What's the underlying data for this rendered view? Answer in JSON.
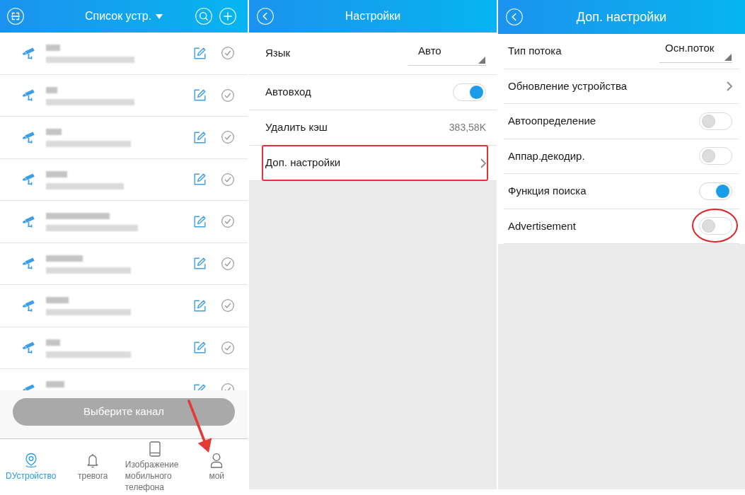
{
  "device_list_screen": {
    "header": {
      "title": "Список устр."
    },
    "devices": [
      {
        "selected": false
      },
      {
        "selected": false
      },
      {
        "selected": false
      },
      {
        "selected": false
      },
      {
        "selected": false
      },
      {
        "selected": false
      },
      {
        "selected": false
      },
      {
        "selected": false
      },
      {
        "selected": false
      }
    ],
    "action_button": {
      "label": "Выберите канал",
      "disabled": true
    },
    "nav_tabs": [
      {
        "label": "DУстройство",
        "selected": true,
        "highlighted": false
      },
      {
        "label": "тревога",
        "selected": false,
        "highlighted": false
      },
      {
        "label": "Изображение мобильного телефона",
        "selected": false,
        "highlighted": false
      },
      {
        "label": "мой",
        "selected": false,
        "highlighted": true
      }
    ]
  },
  "settings_screen": {
    "title": "Настройки",
    "rows": [
      {
        "kind": "dropdown",
        "label": "Язык",
        "value": "Авто",
        "highlighted": false
      },
      {
        "kind": "toggle",
        "label": "Автовход",
        "on": true,
        "highlighted": false
      },
      {
        "kind": "value",
        "label": "Удалить кэш",
        "value": "383,58K",
        "highlighted": false
      },
      {
        "kind": "link",
        "label": "Доп. настройки",
        "highlighted": true
      }
    ]
  },
  "advanced_settings_screen": {
    "title": "Доп. настройки",
    "rows": [
      {
        "kind": "dropdown",
        "label": "Тип потока",
        "value": "Осн.поток",
        "highlighted": false
      },
      {
        "kind": "link",
        "label": "Обновление устройства",
        "highlighted": false
      },
      {
        "kind": "toggle",
        "label": "Автоопределение",
        "on": false,
        "highlighted": false
      },
      {
        "kind": "toggle",
        "label": "Аппар.декодир.",
        "on": false,
        "highlighted": false
      },
      {
        "kind": "toggle",
        "label": "Функция поиска",
        "on": true,
        "highlighted": false
      },
      {
        "kind": "toggle",
        "label": "Advertisement",
        "on": false,
        "highlighted": true
      }
    ]
  }
}
